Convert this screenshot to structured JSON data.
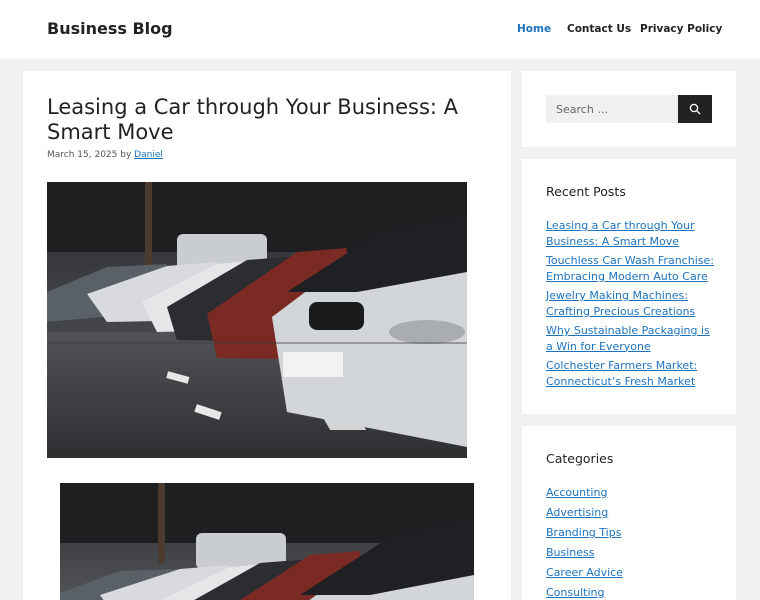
{
  "site": {
    "title": "Business Blog"
  },
  "nav": {
    "home": "Home",
    "contact": "Contact Us",
    "privacy": "Privacy Policy"
  },
  "post": {
    "title": "Leasing a Car through Your Business: A Smart Move",
    "date": "March 15, 2025",
    "by": "by",
    "author": "Daniel"
  },
  "search": {
    "placeholder": "Search …",
    "icon": "search-icon"
  },
  "recent": {
    "title": "Recent Posts",
    "items": [
      "Leasing a Car through Your Business: A Smart Move",
      "Touchless Car Wash Franchise: Embracing Modern Auto Care",
      "Jewelry Making Machines: Crafting Precious Creations",
      "Why Sustainable Packaging is a Win for Everyone",
      "Colchester Farmers Market: Connecticut’s Fresh Market"
    ]
  },
  "categories": {
    "title": "Categories",
    "items": [
      "Accounting",
      "Advertising",
      "Branding Tips",
      "Business",
      "Career Advice",
      "Consulting"
    ]
  },
  "colors": {
    "link": "#1e73be",
    "page_bg": "#eff1f3",
    "search_button": "#222222"
  }
}
